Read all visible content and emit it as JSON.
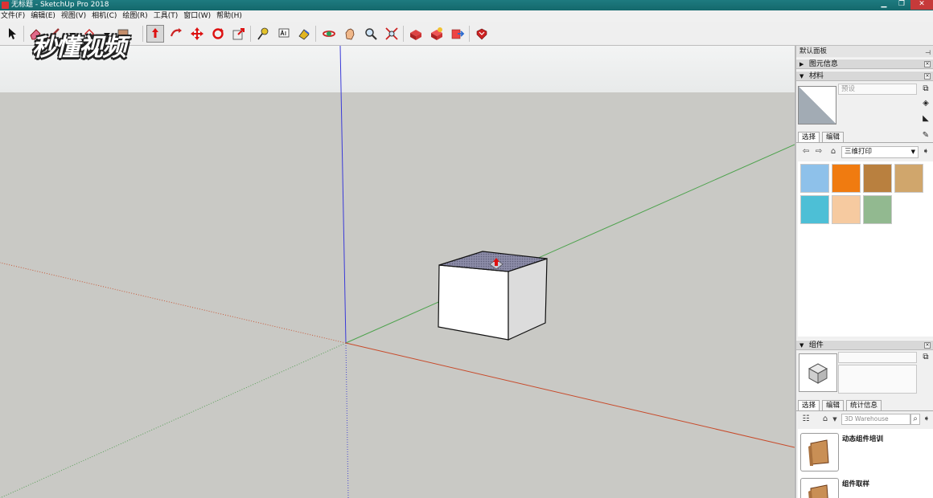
{
  "window": {
    "title": "无标题 - SketchUp Pro 2018",
    "minimize": "▁",
    "maximize": "❐",
    "close": "✕"
  },
  "menu": [
    "文件(F)",
    "编辑(E)",
    "视图(V)",
    "相机(C)",
    "绘图(R)",
    "工具(T)",
    "窗口(W)",
    "帮助(H)"
  ],
  "watermark": "秒懂视频",
  "tray": {
    "title": "默认面板",
    "pin": "⊣",
    "entity_info": {
      "label": "图元信息",
      "arrow": "▶"
    },
    "materials": {
      "label": "材料",
      "arrow": "▼",
      "name_placeholder": "预设",
      "tabs": [
        "选择",
        "编辑"
      ],
      "collection": "三维打印",
      "swatches": [
        "#8ec1ea",
        "#f07b10",
        "#b9803f",
        "#d0a66c",
        "#4dbfd6",
        "#f6caa0",
        "#92b990"
      ]
    },
    "components": {
      "label": "组件",
      "arrow": "▼",
      "tabs": [
        "选择",
        "编辑",
        "统计信息"
      ],
      "search_placeholder": "3D Warehouse",
      "items": [
        "动态组件培训",
        "组件取样"
      ]
    }
  }
}
